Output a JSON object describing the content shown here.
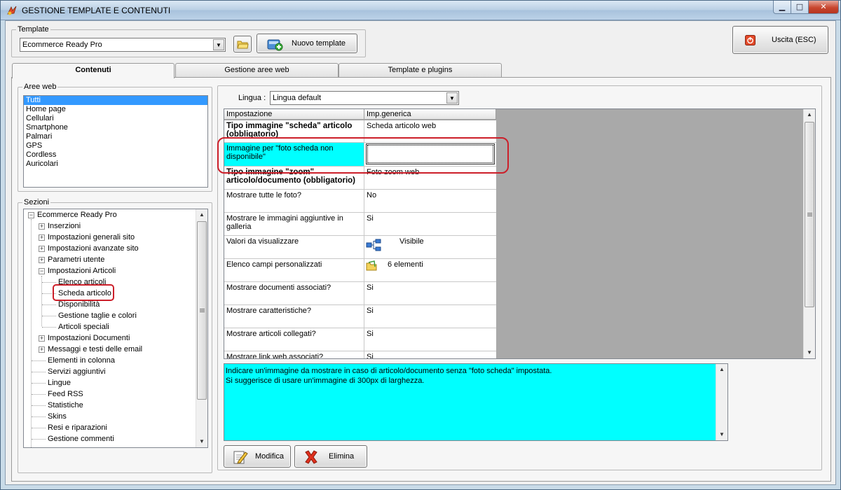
{
  "window": {
    "title": "GESTIONE TEMPLATE E CONTENUTI"
  },
  "template_group": {
    "legend": "Template",
    "selected": "Ecommerce Ready Pro",
    "new_button": "Nuovo template"
  },
  "exit_button": "Uscita (ESC)",
  "tabs": [
    "Contenuti",
    "Gestione aree web",
    "Template e plugins"
  ],
  "aree_web": {
    "legend": "Aree web",
    "items": [
      "Tutti",
      "Home page",
      "Cellulari",
      "Smartphone",
      "Palmari",
      "GPS",
      "Cordless",
      "Auricolari"
    ]
  },
  "sezioni": {
    "legend": "Sezioni",
    "root": "Ecommerce Ready Pro",
    "nodes": [
      "Inserzioni",
      "Impostazioni generali sito",
      "Impostazioni avanzate sito",
      "Parametri utente",
      "Impostazioni Articoli",
      "Elenco articoli",
      "Scheda articolo",
      "Disponibilità",
      "Gestione taglie e colori",
      "Articoli speciali",
      "Impostazioni Documenti",
      "Messaggi e testi delle email",
      "Elementi in colonna",
      "Servizi aggiuntivi",
      "Lingue",
      "Feed RSS",
      "Statistiche",
      "Skins",
      "Resi e riparazioni",
      "Gestione commenti"
    ]
  },
  "lingua": {
    "label": "Lingua :",
    "selected": "Lingua default"
  },
  "grid": {
    "headers": [
      "Impostazione",
      "Imp.generica"
    ],
    "rows": [
      {
        "name": "Tipo immagine \"scheda\" articolo (obbligatorio)",
        "value": "Scheda articolo web"
      },
      {
        "name": "Immagine per \"foto scheda non disponibile\"",
        "value": ""
      },
      {
        "name": "Tipo immagine \"zoom\" articolo/documento (obbligatorio)",
        "value": "Foto zoom web"
      },
      {
        "name": "Mostrare tutte le foto?",
        "value": "No"
      },
      {
        "name": "Mostrare le immagini aggiuntive in galleria",
        "value": "Si"
      },
      {
        "name": "Valori da visualizzare",
        "value": "Visibile"
      },
      {
        "name": "Elenco campi personalizzati",
        "value": "6 elementi"
      },
      {
        "name": "Mostrare documenti associati?",
        "value": "Si"
      },
      {
        "name": "Mostrare caratteristiche?",
        "value": "Si"
      },
      {
        "name": "Mostrare articoli collegati?",
        "value": "Si"
      },
      {
        "name": "Mostrare link web associati?",
        "value": "Si"
      }
    ]
  },
  "description": "Indicare un'immagine da mostrare in caso di articolo/documento senza \"foto scheda\" impostata.\nSi suggerisce di usare un'immagine di 300px di larghezza.",
  "buttons": {
    "modifica": "Modifica",
    "elimina": "Elimina"
  }
}
